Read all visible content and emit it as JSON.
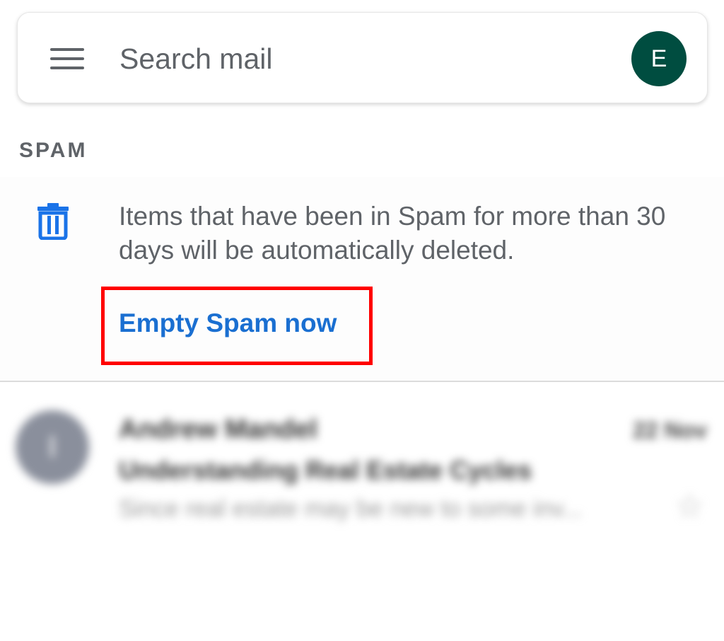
{
  "header": {
    "menu_icon": "hamburger-menu-icon",
    "search": {
      "placeholder": "Search mail",
      "value": ""
    },
    "avatar": {
      "letter": "E",
      "color": "#004d40"
    }
  },
  "section": {
    "label": "SPAM"
  },
  "banner": {
    "icon": "trash-icon",
    "icon_color": "#1a73e8",
    "text": "Items that have been in Spam for more than 30 days will be automatically deleted.",
    "action_label": "Empty Spam now",
    "action_color": "#1a6fd1",
    "highlight_color": "#ff0000"
  },
  "emails": [
    {
      "avatar_letter": "I",
      "sender": "Andrew Mandel",
      "date": "22 Nov",
      "subject": "Understanding Real Estate Cycles",
      "snippet": "Since real estate may be new to some inv...",
      "star_icon": "star-outline-icon"
    }
  ]
}
